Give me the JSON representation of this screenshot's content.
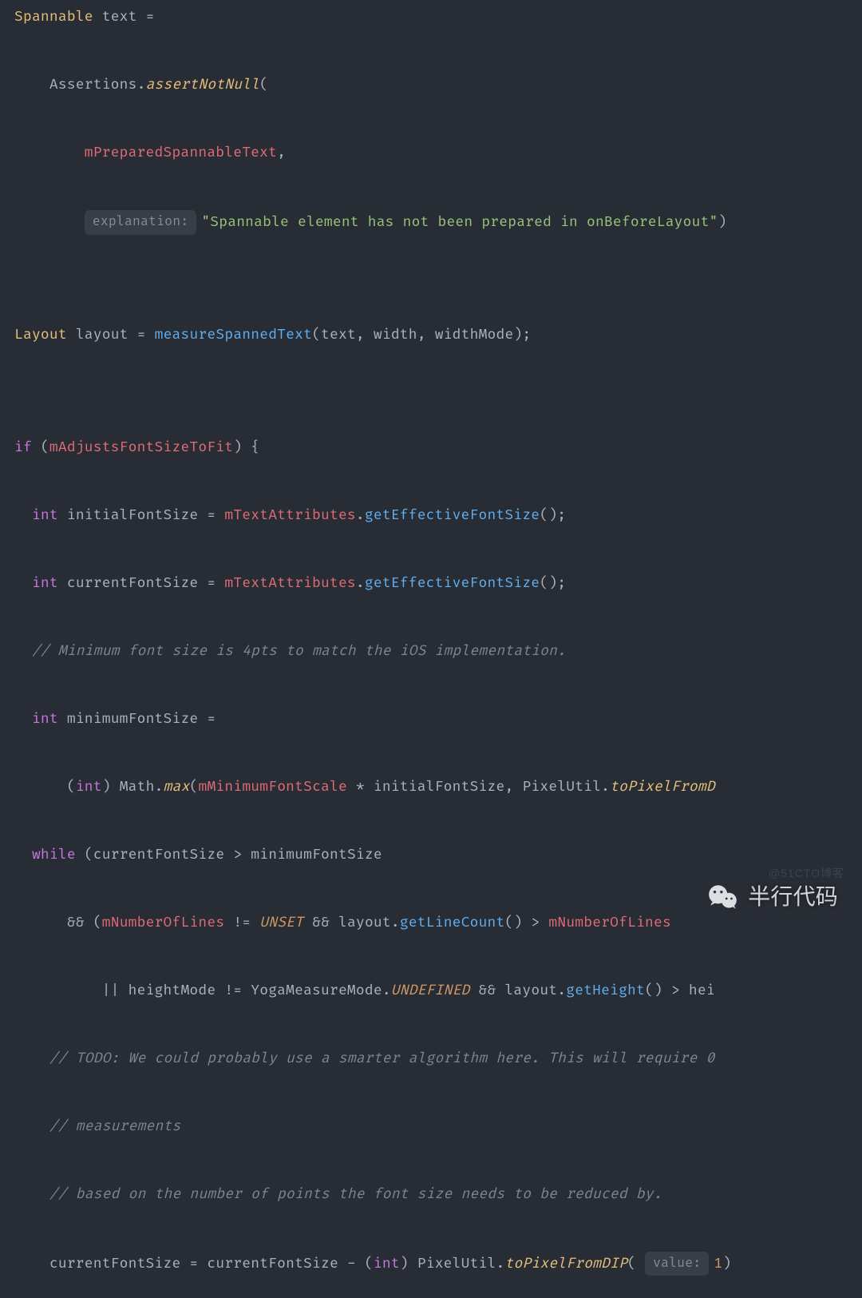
{
  "code": {
    "l1": {
      "a": "Spannable",
      "b": "text",
      "c": "="
    },
    "l2": {
      "a": "Assertions",
      "b": "assertNotNull"
    },
    "l3": {
      "a": "mPreparedSpannableText"
    },
    "l4": {
      "hint": "explanation:",
      "str": "\"Spannable element has not been prepared in onBeforeLayout\""
    },
    "l5": {
      "a": "Layout",
      "b": "layout",
      "c": "=",
      "d": "measureSpannedText",
      "e": "text",
      "f": "width",
      "g": "widthMode"
    },
    "l6": {
      "a": "if",
      "b": "mAdjustsFontSizeToFit"
    },
    "l7": {
      "a": "int",
      "b": "initialFontSize",
      "c": "=",
      "d": "mTextAttributes",
      "e": "getEffectiveFontSize"
    },
    "l8": {
      "a": "int",
      "b": "currentFontSize",
      "c": "=",
      "d": "mTextAttributes",
      "e": "getEffectiveFontSize"
    },
    "l9": {
      "a": "// Minimum font size is 4pts to match the iOS implementation."
    },
    "l10": {
      "a": "int",
      "b": "minimumFontSize",
      "c": "="
    },
    "l11": {
      "a": "int",
      "b": "Math",
      "c": "max",
      "d": "mMinimumFontScale",
      "e": "*",
      "f": "initialFontSize",
      "g": "PixelUtil",
      "h": "toPixelFromD"
    },
    "l12": {
      "a": "while",
      "b": "currentFontSize",
      "c": ">",
      "d": "minimumFontSize"
    },
    "l13": {
      "a": "&&",
      "b": "mNumberOfLines",
      "c": "!=",
      "d": "UNSET",
      "e": "&&",
      "f": "layout",
      "g": "getLineCount",
      "h": ">",
      "i": "mNumberOfLines"
    },
    "l14": {
      "a": "||",
      "b": "heightMode",
      "c": "!=",
      "d": "YogaMeasureMode",
      "e": "UNDEFINED",
      "f": "&&",
      "g": "layout",
      "h": "getHeight",
      "i": ">",
      "j": "hei"
    },
    "l15": {
      "a": "// TODO: We could probably use a smarter algorithm here. This will require 0"
    },
    "l16": {
      "a": "// measurements"
    },
    "l17": {
      "a": "// based on the number of points the font size needs to be reduced by."
    },
    "l18": {
      "a": "currentFontSize",
      "b": "=",
      "c": "currentFontSize",
      "d": "-",
      "e": "int",
      "f": "PixelUtil",
      "g": "toPixelFromDIP",
      "hint": "value:",
      "h": "1"
    }
  },
  "overlay": {
    "wechat_label": "半行代码",
    "watermark": "@51CTO博客"
  }
}
